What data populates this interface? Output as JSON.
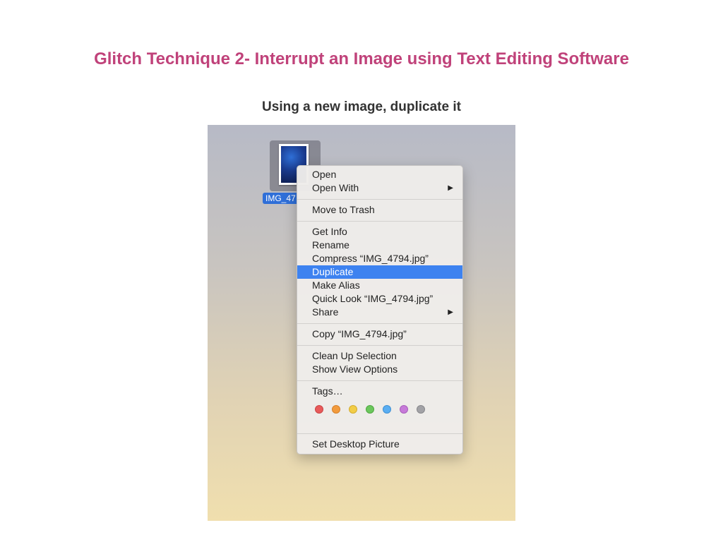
{
  "slide": {
    "title": "Glitch Technique 2- Interrupt an Image using Text Editing Software",
    "subtitle": "Using a new image, duplicate it"
  },
  "desktop": {
    "file_icon": {
      "label": "IMG_47",
      "icon": "image-file-icon"
    }
  },
  "context_menu": {
    "open": "Open",
    "open_with": "Open With",
    "move_to_trash": "Move to Trash",
    "get_info": "Get Info",
    "rename": "Rename",
    "compress": "Compress “IMG_4794.jpg”",
    "duplicate": "Duplicate",
    "make_alias": "Make Alias",
    "quick_look": "Quick Look “IMG_4794.jpg”",
    "share": "Share",
    "copy": "Copy “IMG_4794.jpg”",
    "clean_up_selection": "Clean Up Selection",
    "show_view_options": "Show View Options",
    "tags": "Tags…",
    "set_desktop_picture": "Set Desktop Picture",
    "submenu_arrow": "▶",
    "selected_item": "Duplicate",
    "tag_colors": [
      {
        "name": "red",
        "fill": "#e85a5a",
        "border": "#c94444"
      },
      {
        "name": "orange",
        "fill": "#f29b3d",
        "border": "#d6812a"
      },
      {
        "name": "yellow",
        "fill": "#f2cd47",
        "border": "#d4ad30"
      },
      {
        "name": "green",
        "fill": "#6bc75c",
        "border": "#50a842"
      },
      {
        "name": "blue",
        "fill": "#5aaef2",
        "border": "#3f91d4"
      },
      {
        "name": "purple",
        "fill": "#c77ad9",
        "border": "#a85fbb"
      },
      {
        "name": "gray",
        "fill": "#a2a2a6",
        "border": "#88888c"
      }
    ]
  },
  "colors": {
    "title": "#c0427a",
    "selection": "#3d82f0",
    "file_label_bg": "#2f6fd8"
  }
}
